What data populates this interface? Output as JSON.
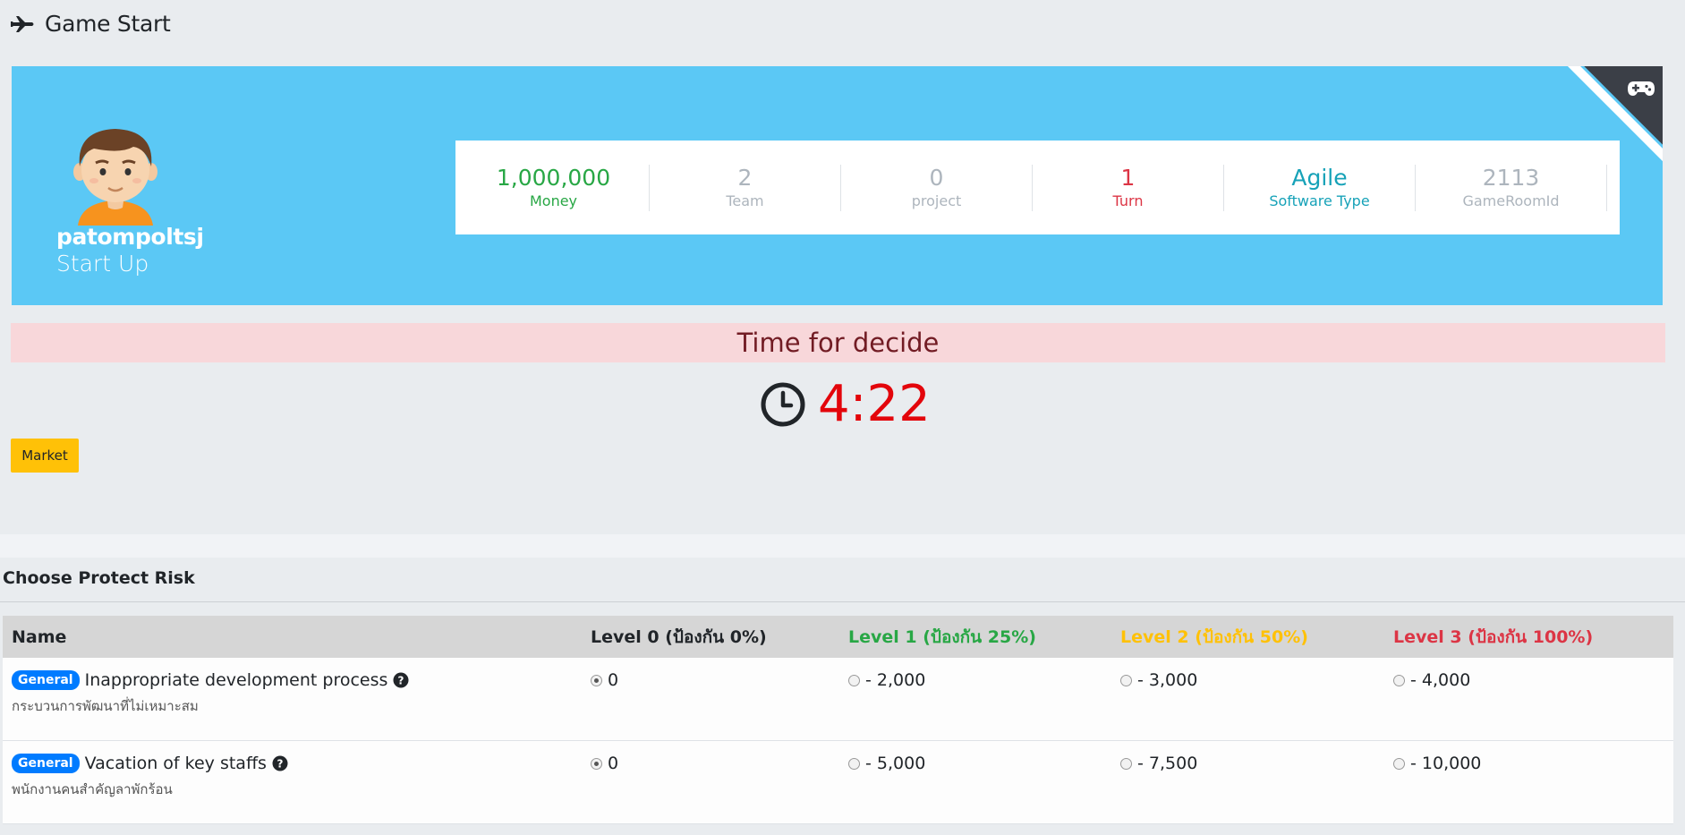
{
  "header": {
    "title": "Game Start",
    "icon": "plane-icon"
  },
  "profile": {
    "username": "patompoltsj",
    "company": "Start Up",
    "card_color": "#5bc8f5",
    "corner_icon": "gamepad-icon"
  },
  "stats": [
    {
      "value": "1,000,000",
      "label": "Money",
      "color": "#28a745"
    },
    {
      "value": "2",
      "label": "Team",
      "color": "#adb5bd"
    },
    {
      "value": "0",
      "label": "project",
      "color": "#adb5bd"
    },
    {
      "value": "1",
      "label": "Turn",
      "color": "#dc3545"
    },
    {
      "value": "Agile",
      "label": "Software Type",
      "color": "#17a2b8"
    },
    {
      "value": "2113",
      "label": "GameRoomId",
      "color": "#adb5bd"
    }
  ],
  "alert": {
    "text": "Time for decide"
  },
  "timer": {
    "value": "4:22",
    "icon": "clock-icon",
    "color": "#e3050b"
  },
  "buttons": {
    "market": "Market"
  },
  "risk": {
    "title": "Choose Protect Risk",
    "columns": {
      "name": "Name",
      "level0": "Level 0 (ป้องกัน 0%)",
      "level1": "Level 1 (ป้องกัน 25%)",
      "level2": "Level 2 (ป้องกัน 50%)",
      "level3": "Level 3 (ป้องกัน 100%)"
    },
    "rows": [
      {
        "badge": "General",
        "name": "Inappropriate development process",
        "subtitle": "กระบวนการพัฒนาที่ไม่เหมาะสม",
        "options": [
          "0",
          "- 2,000",
          "- 3,000",
          "- 4,000"
        ],
        "selected": 0
      },
      {
        "badge": "General",
        "name": "Vacation of key staffs",
        "subtitle": "พนักงานคนสำคัญลาพักร้อน",
        "options": [
          "0",
          "- 5,000",
          "- 7,500",
          "- 10,000"
        ],
        "selected": 0
      }
    ]
  }
}
